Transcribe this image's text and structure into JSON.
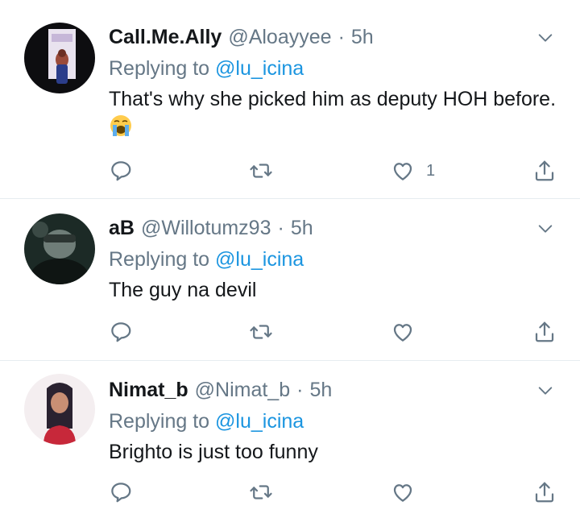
{
  "colors": {
    "text": "#14171a",
    "secondary": "#657786",
    "link": "#1b95e0",
    "divider": "#e6ecf0",
    "icon": "#657786"
  },
  "replies": [
    {
      "name": "Call.Me.Ally",
      "handle": "@Aloayyee",
      "dot": "·",
      "time": "5h",
      "replying_prefix": "Replying to",
      "replying_to": "@lu_icina",
      "text": "That's why she picked him as deputy HOH before.",
      "emoji": "😭",
      "reply_count": "",
      "retweet_count": "",
      "like_count": "1",
      "icons": [
        "reply-icon",
        "retweet-icon",
        "like-icon",
        "share-icon",
        "chevron-down-icon"
      ]
    },
    {
      "name": "aB",
      "handle": "@Willotumz93",
      "dot": "·",
      "time": "5h",
      "replying_prefix": "Replying to",
      "replying_to": "@lu_icina",
      "text": "The guy na devil",
      "reply_count": "",
      "retweet_count": "",
      "like_count": "",
      "icons": [
        "reply-icon",
        "retweet-icon",
        "like-icon",
        "share-icon",
        "chevron-down-icon"
      ]
    },
    {
      "name": "Nimat_b",
      "handle": "@Nimat_b",
      "dot": "·",
      "time": "5h",
      "replying_prefix": "Replying to",
      "replying_to": "@lu_icina",
      "text": "Brighto is just too funny",
      "reply_count": "",
      "retweet_count": "",
      "like_count": "",
      "icons": [
        "reply-icon",
        "retweet-icon",
        "like-icon",
        "share-icon",
        "chevron-down-icon"
      ]
    }
  ]
}
